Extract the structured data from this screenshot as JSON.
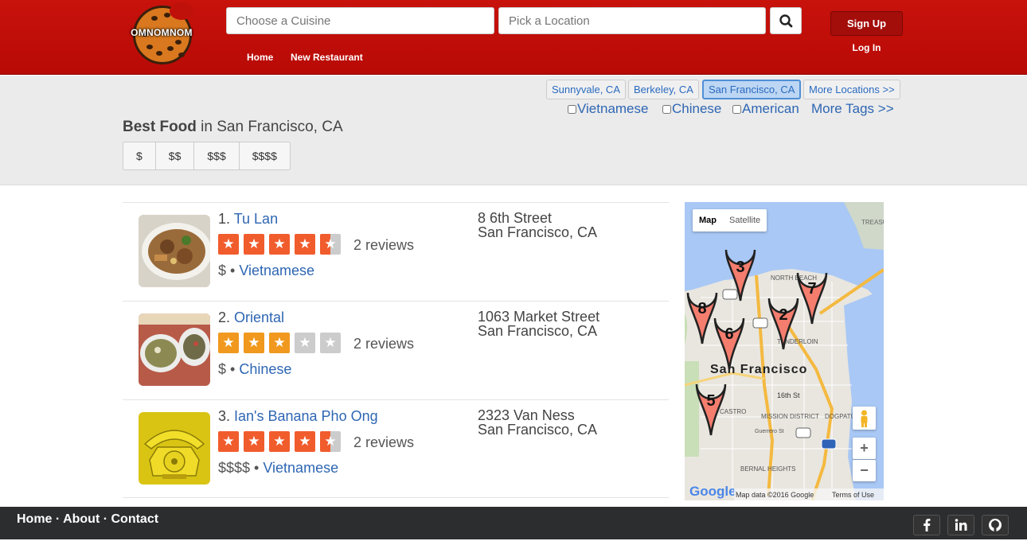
{
  "header": {
    "logo_text": "OMNOMNOM",
    "cuisine_placeholder": "Choose a Cuisine",
    "location_placeholder": "Pick a Location",
    "nav": [
      "Home",
      "New Restaurant"
    ],
    "signup_label": "Sign Up",
    "login_label": "Log In"
  },
  "filters": {
    "locations": [
      "Sunnyvale, CA",
      "Berkeley, CA",
      "San Francisco, CA",
      "More Locations >>"
    ],
    "active_location": "San Francisco, CA",
    "tags": [
      "Vietnamese",
      "Chinese",
      "American"
    ],
    "more_tags": "More Tags >>",
    "heading_bold": "Best Food",
    "heading_rest": " in San Francisco, CA",
    "prices": [
      "$",
      "$$",
      "$$$",
      "$$$$"
    ]
  },
  "results": [
    {
      "rank": "1.",
      "name": "Tu Lan",
      "rating": 4.5,
      "reviews": "2 reviews",
      "price": "$",
      "category": "Vietnamese",
      "street": "8 6th Street",
      "city": "San Francisco, CA"
    },
    {
      "rank": "2.",
      "name": "Oriental",
      "rating": 3,
      "reviews": "2 reviews",
      "price": "$",
      "category": "Chinese",
      "street": "1063 Market Street",
      "city": "San Francisco, CA"
    },
    {
      "rank": "3.",
      "name": "Ian's Banana Pho Ong",
      "rating": 4.5,
      "reviews": "2 reviews",
      "price": "$$$$",
      "category": "Vietnamese",
      "street": "2323 Van Ness",
      "city": "San Francisco, CA"
    }
  ],
  "map": {
    "toggle": [
      "Map",
      "Satellite"
    ],
    "city_label": "San Francisco",
    "labels": [
      "NORTH BEACH",
      "TENDERLOIN",
      "16th St",
      "MISSION DISTRICT",
      "CASTRO",
      "DOGPATCH",
      "BERNAL HEIGHTS",
      "TREASURE ISLAND",
      "Guerrero St"
    ],
    "pins": [
      "3",
      "7",
      "8",
      "2",
      "6",
      "5"
    ],
    "google": "Google",
    "attribution": "Map data ©2016 Google",
    "terms": "Terms of Use",
    "zoom_in": "+",
    "zoom_out": "−"
  },
  "footer": {
    "links": [
      "Home",
      "About",
      "Contact"
    ],
    "separator": " · ",
    "social": [
      "facebook-icon",
      "linkedin-icon",
      "github-icon"
    ]
  },
  "colors": {
    "header": "#c0100a",
    "star_high": "#f15c2d",
    "star_mid": "#f0991e",
    "star_off": "#cccccc",
    "link": "#2e66b3"
  }
}
